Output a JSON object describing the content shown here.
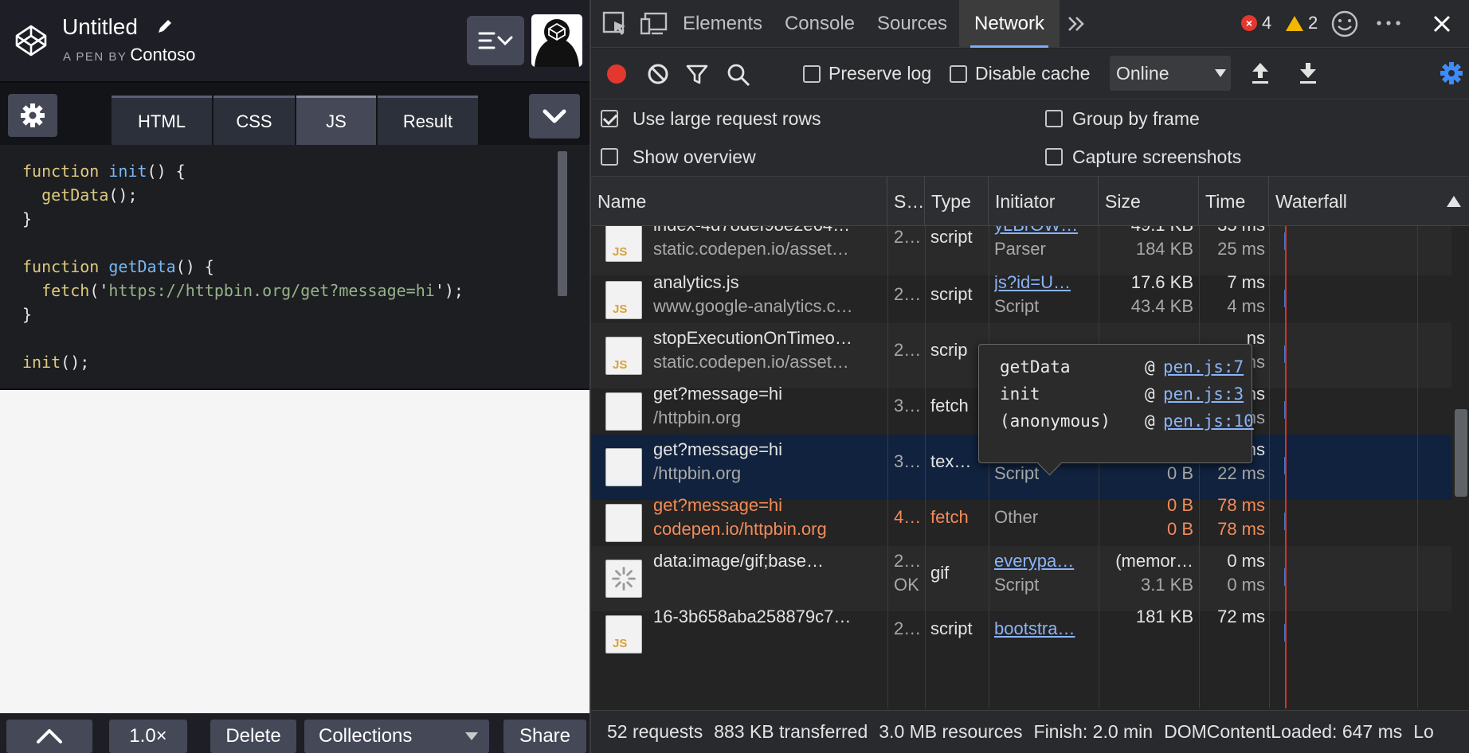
{
  "codepen": {
    "title": "Untitled",
    "byline": "A PEN BY",
    "author": "Contoso",
    "tabs": [
      "HTML",
      "CSS",
      "JS",
      "Result"
    ],
    "active_tab": "JS",
    "code": {
      "l1_kw": "function",
      "l1_fn": "init",
      "l1_rest": "() {",
      "l2_fn": "getData",
      "l2_rest": "();",
      "l3": "}",
      "l5_kw": "function",
      "l5_fn": "getData",
      "l5_rest": "() {",
      "l6_fn": "fetch",
      "l6_open": "('",
      "l6_str": "https://httpbin.org/get?message=hi",
      "l6_close": "');",
      "l7": "}",
      "l9_fn": "init",
      "l9_rest": "();"
    },
    "footer": {
      "zoom": "1.0×",
      "delete": "Delete",
      "collections": "Collections",
      "share": "Share"
    }
  },
  "devtools": {
    "tabs": [
      "Elements",
      "Console",
      "Sources",
      "Network"
    ],
    "active_tab": "Network",
    "errors": "4",
    "warnings": "2",
    "toolbar": {
      "preserve_log": "Preserve log",
      "disable_cache": "Disable cache",
      "throttle": "Online"
    },
    "settings": {
      "large_rows": "Use large request rows",
      "group_by_frame": "Group by frame",
      "show_overview": "Show overview",
      "capture_screenshots": "Capture screenshots"
    },
    "columns": [
      "Name",
      "S…",
      "Type",
      "Initiator",
      "Size",
      "Time",
      "Waterfall"
    ],
    "rows": [
      {
        "name": "index-4d78def98e2e64…",
        "path": "static.codepen.io/asset…",
        "status": "2…",
        "type": "script",
        "init": "yLBrOW…",
        "init2": "Parser",
        "size": "49.1 KB",
        "size2": "184 KB",
        "time": "35 ms",
        "time2": "25 ms",
        "icon": "js"
      },
      {
        "name": "analytics.js",
        "path": "www.google-analytics.c…",
        "status": "2…",
        "type": "script",
        "init": "js?id=U…",
        "init2": "Script",
        "size": "17.6 KB",
        "size2": "43.4 KB",
        "time": "7 ms",
        "time2": "4 ms",
        "icon": "js"
      },
      {
        "name": "stopExecutionOnTimeo…",
        "path": "static.codepen.io/asset…",
        "status": "2…",
        "type": "scrip",
        "init": "",
        "init2": "",
        "size": "",
        "size2": "",
        "time": "ns",
        "time2": "ns",
        "icon": "js"
      },
      {
        "name": "get?message=hi",
        "path": "/httpbin.org",
        "status": "3…",
        "type": "fetch",
        "init": "",
        "init2": "",
        "size": "",
        "size2": "",
        "time": "ns",
        "time2": "ns",
        "icon": "blank"
      },
      {
        "name": "get?message=hi",
        "path": "/httpbin.org",
        "status": "3…",
        "type": "tex…",
        "init": "pen.js:7",
        "init2": "Script",
        "size": "79 B",
        "size2": "0 B",
        "time": "23 ms",
        "time2": "22 ms",
        "icon": "blank"
      },
      {
        "name": "get?message=hi",
        "path": "codepen.io/httpbin.org",
        "status": "4…",
        "type": "fetch",
        "init": "",
        "init2": "Other",
        "size": "0 B",
        "size2": "0 B",
        "time": "78 ms",
        "time2": "78 ms",
        "icon": "blank"
      },
      {
        "name": "data:image/gif;base…",
        "path": "",
        "status": "2…",
        "status2": "OK",
        "type": "gif",
        "init": "everypa…",
        "init2": "Script",
        "size": "(memor…",
        "size2": "3.1 KB",
        "time": "0 ms",
        "time2": "0 ms",
        "icon": "spinner"
      },
      {
        "name": "16-3b658aba258879c7…",
        "path": "",
        "status": "2…",
        "type": "script",
        "init": "bootstra…",
        "init2": "",
        "size": "181 KB",
        "size2": "",
        "time": "72 ms",
        "time2": "",
        "icon": "js"
      }
    ],
    "tooltip": [
      {
        "fn": "getData",
        "at": "@",
        "link": "pen.js:7"
      },
      {
        "fn": "init",
        "at": "@",
        "link": "pen.js:3"
      },
      {
        "fn": "(anonymous)",
        "at": "@",
        "link": "pen.js:10"
      }
    ],
    "status": {
      "requests": "52 requests",
      "transferred": "883 KB transferred",
      "resources": "3.0 MB resources",
      "finish": "Finish: 2.0 min",
      "dcl": "DOMContentLoaded: 647 ms",
      "load": "Lo"
    }
  }
}
